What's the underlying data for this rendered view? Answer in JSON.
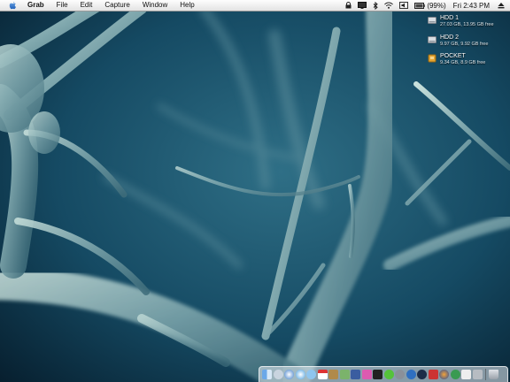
{
  "menubar": {
    "app_name": "Grab",
    "menus": [
      "File",
      "Edit",
      "Capture",
      "Window",
      "Help"
    ],
    "status": {
      "battery": "(99%)",
      "clock": "Fri 2:43 PM"
    }
  },
  "drives": [
    {
      "name": "HDD 1",
      "info": "27.03 GB, 13.95 GB free"
    },
    {
      "name": "HDD 2",
      "info": "9.97 GB, 9.92 GB free"
    },
    {
      "name": "POCKET",
      "info": "9.34 GB, 8.9 GB free"
    }
  ],
  "colors": {
    "wallpaper_base": "#0b2a3c",
    "neuron": "#9fc3c6",
    "menubar": "#e9e9e9",
    "pocket_drive": "#e6a532"
  },
  "dock": {
    "icons": [
      "finder",
      "mail",
      "safari",
      "itunes",
      "ichat",
      "ical",
      "address-book",
      "preview",
      "photoshop",
      "calculator",
      "terminal",
      "skype",
      "system-preferences",
      "network",
      "dashboard",
      "flash",
      "firefox",
      "messenger",
      "textedit",
      "grab",
      "trash"
    ]
  }
}
